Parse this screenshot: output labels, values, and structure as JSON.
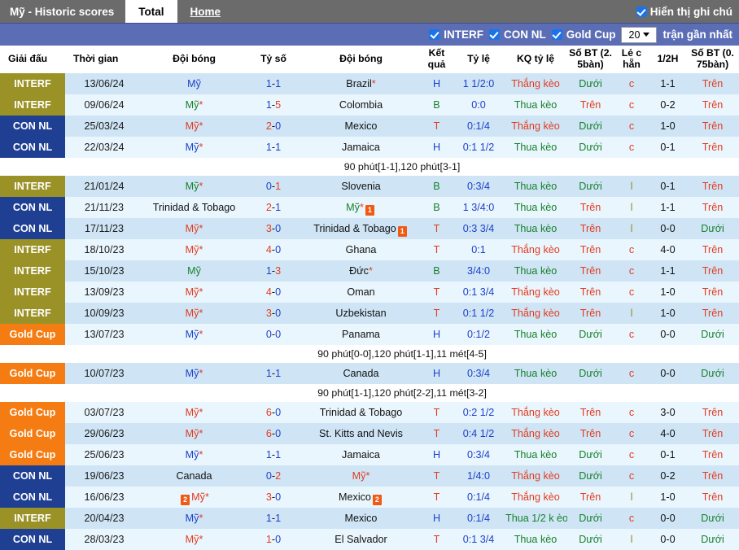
{
  "topbar": {
    "title": "Mỹ - Historic scores",
    "tab_total": "Total",
    "tab_home": "Home",
    "show_notes_label": "Hiển thị ghi chú"
  },
  "filterbar": {
    "f1": "INTERF",
    "f2": "CON NL",
    "f3": "Gold Cup",
    "count_value": "20",
    "count_label": "trận gần nhất"
  },
  "columns": {
    "c0": "Giải đấu",
    "c1": "Thời gian",
    "c2": "Đội bóng",
    "c3": "Tỷ số",
    "c4": "Đội bóng",
    "c5": "Kết quả",
    "c6": "Tỷ lệ",
    "c7": "KQ tỷ lệ",
    "c8": "Số BT (2. 5bàn)",
    "c9": "Lẻ c hẵn",
    "c10": "1/2H",
    "c11": "Số BT (0. 75bàn)"
  },
  "rows": [
    {
      "kind": "match",
      "comp": "INTERF",
      "comp_class": "c-interf",
      "date": "13/06/24",
      "home": "Mỹ",
      "home_class": "tm-blue",
      "home_star": "",
      "home_card": "",
      "score": "1-1",
      "score_h_class": "sc-blue",
      "score_a_class": "sc-blue",
      "away": "Brazil",
      "away_class": "tm-black",
      "away_star": "*",
      "away_card": "",
      "res": "H",
      "res_class": "v-blue",
      "odds": "1 1/2:0",
      "odds_class": "v-blue",
      "kq": "Thắng kèo",
      "kq_class": "v-red",
      "bt25": "Dưới",
      "bt25_class": "v-green",
      "oe": "c",
      "oe_class": "v-red",
      "half": "1-1",
      "half_class": "tm-black",
      "bt075": "Trên",
      "bt075_class": "v-red"
    },
    {
      "kind": "match",
      "comp": "INTERF",
      "comp_class": "c-interf",
      "date": "09/06/24",
      "home": "Mỹ",
      "home_class": "tm-green",
      "home_star": "*",
      "home_card": "",
      "score": "1-5",
      "score_h_class": "sc-blue",
      "score_a_class": "sc-red",
      "away": "Colombia",
      "away_class": "tm-black",
      "away_star": "",
      "away_card": "",
      "res": "B",
      "res_class": "v-green",
      "odds": "0:0",
      "odds_class": "v-blue",
      "kq": "Thua kèo",
      "kq_class": "v-green",
      "bt25": "Trên",
      "bt25_class": "v-red",
      "oe": "c",
      "oe_class": "v-red",
      "half": "0-2",
      "half_class": "tm-black",
      "bt075": "Trên",
      "bt075_class": "v-red"
    },
    {
      "kind": "match",
      "comp": "CON NL",
      "comp_class": "c-connl",
      "date": "25/03/24",
      "home": "Mỹ",
      "home_class": "tm-red",
      "home_star": "*",
      "home_card": "",
      "score": "2-0",
      "score_h_class": "sc-red",
      "score_a_class": "sc-blue",
      "away": "Mexico",
      "away_class": "tm-black",
      "away_star": "",
      "away_card": "",
      "res": "T",
      "res_class": "v-red",
      "odds": "0:1/4",
      "odds_class": "v-blue",
      "kq": "Thắng kèo",
      "kq_class": "v-red",
      "bt25": "Dưới",
      "bt25_class": "v-green",
      "oe": "c",
      "oe_class": "v-red",
      "half": "1-0",
      "half_class": "tm-black",
      "bt075": "Trên",
      "bt075_class": "v-red"
    },
    {
      "kind": "match",
      "comp": "CON NL",
      "comp_class": "c-connl",
      "date": "22/03/24",
      "home": "Mỹ",
      "home_class": "tm-blue",
      "home_star": "*",
      "home_card": "",
      "score": "1-1",
      "score_h_class": "sc-blue",
      "score_a_class": "sc-blue",
      "away": "Jamaica",
      "away_class": "tm-black",
      "away_star": "",
      "away_card": "",
      "res": "H",
      "res_class": "v-blue",
      "odds": "0:1 1/2",
      "odds_class": "v-blue",
      "kq": "Thua kèo",
      "kq_class": "v-green",
      "bt25": "Dưới",
      "bt25_class": "v-green",
      "oe": "c",
      "oe_class": "v-red",
      "half": "0-1",
      "half_class": "tm-black",
      "bt075": "Trên",
      "bt075_class": "v-red"
    },
    {
      "kind": "note",
      "text": "90 phút[1-1],120 phút[3-1]"
    },
    {
      "kind": "match",
      "comp": "INTERF",
      "comp_class": "c-interf",
      "date": "21/01/24",
      "home": "Mỹ",
      "home_class": "tm-green",
      "home_star": "*",
      "home_card": "",
      "score": "0-1",
      "score_h_class": "sc-blue",
      "score_a_class": "sc-red",
      "away": "Slovenia",
      "away_class": "tm-black",
      "away_star": "",
      "away_card": "",
      "res": "B",
      "res_class": "v-green",
      "odds": "0:3/4",
      "odds_class": "v-blue",
      "kq": "Thua kèo",
      "kq_class": "v-green",
      "bt25": "Dưới",
      "bt25_class": "v-green",
      "oe": "l",
      "oe_class": "v-olive",
      "half": "0-1",
      "half_class": "tm-black",
      "bt075": "Trên",
      "bt075_class": "v-red"
    },
    {
      "kind": "match",
      "comp": "CON NL",
      "comp_class": "c-connl",
      "date": "21/11/23",
      "home": "Trinidad & Tobago",
      "home_class": "tm-black",
      "home_star": "",
      "home_card": "",
      "score": "2-1",
      "score_h_class": "sc-red",
      "score_a_class": "sc-blue",
      "away": "Mỹ",
      "away_class": "tm-green",
      "away_star": "*",
      "away_card": "1",
      "res": "B",
      "res_class": "v-green",
      "odds": "1 3/4:0",
      "odds_class": "v-blue",
      "kq": "Thua kèo",
      "kq_class": "v-green",
      "bt25": "Trên",
      "bt25_class": "v-red",
      "oe": "l",
      "oe_class": "v-olive",
      "half": "1-1",
      "half_class": "tm-black",
      "bt075": "Trên",
      "bt075_class": "v-red"
    },
    {
      "kind": "match",
      "comp": "CON NL",
      "comp_class": "c-connl",
      "date": "17/11/23",
      "home": "Mỹ",
      "home_class": "tm-red",
      "home_star": "*",
      "home_card": "",
      "score": "3-0",
      "score_h_class": "sc-red",
      "score_a_class": "sc-blue",
      "away": "Trinidad & Tobago",
      "away_class": "tm-black",
      "away_star": "",
      "away_card": "1",
      "res": "T",
      "res_class": "v-red",
      "odds": "0:3 3/4",
      "odds_class": "v-blue",
      "kq": "Thua kèo",
      "kq_class": "v-green",
      "bt25": "Trên",
      "bt25_class": "v-red",
      "oe": "l",
      "oe_class": "v-olive",
      "half": "0-0",
      "half_class": "tm-black",
      "bt075": "Dưới",
      "bt075_class": "v-green"
    },
    {
      "kind": "match",
      "comp": "INTERF",
      "comp_class": "c-interf",
      "date": "18/10/23",
      "home": "Mỹ",
      "home_class": "tm-red",
      "home_star": "*",
      "home_card": "",
      "score": "4-0",
      "score_h_class": "sc-red",
      "score_a_class": "sc-blue",
      "away": "Ghana",
      "away_class": "tm-black",
      "away_star": "",
      "away_card": "",
      "res": "T",
      "res_class": "v-red",
      "odds": "0:1",
      "odds_class": "v-blue",
      "kq": "Thắng kèo",
      "kq_class": "v-red",
      "bt25": "Trên",
      "bt25_class": "v-red",
      "oe": "c",
      "oe_class": "v-red",
      "half": "4-0",
      "half_class": "tm-black",
      "bt075": "Trên",
      "bt075_class": "v-red"
    },
    {
      "kind": "match",
      "comp": "INTERF",
      "comp_class": "c-interf",
      "date": "15/10/23",
      "home": "Mỹ",
      "home_class": "tm-green",
      "home_star": "",
      "home_card": "",
      "score": "1-3",
      "score_h_class": "sc-blue",
      "score_a_class": "sc-red",
      "away": "Đức",
      "away_class": "tm-black",
      "away_star": "*",
      "away_card": "",
      "res": "B",
      "res_class": "v-green",
      "odds": "3/4:0",
      "odds_class": "v-blue",
      "kq": "Thua kèo",
      "kq_class": "v-green",
      "bt25": "Trên",
      "bt25_class": "v-red",
      "oe": "c",
      "oe_class": "v-red",
      "half": "1-1",
      "half_class": "tm-black",
      "bt075": "Trên",
      "bt075_class": "v-red"
    },
    {
      "kind": "match",
      "comp": "INTERF",
      "comp_class": "c-interf",
      "date": "13/09/23",
      "home": "Mỹ",
      "home_class": "tm-red",
      "home_star": "*",
      "home_card": "",
      "score": "4-0",
      "score_h_class": "sc-red",
      "score_a_class": "sc-blue",
      "away": "Oman",
      "away_class": "tm-black",
      "away_star": "",
      "away_card": "",
      "res": "T",
      "res_class": "v-red",
      "odds": "0:1 3/4",
      "odds_class": "v-blue",
      "kq": "Thắng kèo",
      "kq_class": "v-red",
      "bt25": "Trên",
      "bt25_class": "v-red",
      "oe": "c",
      "oe_class": "v-red",
      "half": "1-0",
      "half_class": "tm-black",
      "bt075": "Trên",
      "bt075_class": "v-red"
    },
    {
      "kind": "match",
      "comp": "INTERF",
      "comp_class": "c-interf",
      "date": "10/09/23",
      "home": "Mỹ",
      "home_class": "tm-red",
      "home_star": "*",
      "home_card": "",
      "score": "3-0",
      "score_h_class": "sc-red",
      "score_a_class": "sc-blue",
      "away": "Uzbekistan",
      "away_class": "tm-black",
      "away_star": "",
      "away_card": "",
      "res": "T",
      "res_class": "v-red",
      "odds": "0:1 1/2",
      "odds_class": "v-blue",
      "kq": "Thắng kèo",
      "kq_class": "v-red",
      "bt25": "Trên",
      "bt25_class": "v-red",
      "oe": "l",
      "oe_class": "v-olive",
      "half": "1-0",
      "half_class": "tm-black",
      "bt075": "Trên",
      "bt075_class": "v-red"
    },
    {
      "kind": "match",
      "comp": "Gold Cup",
      "comp_class": "c-goldcup",
      "date": "13/07/23",
      "home": "Mỹ",
      "home_class": "tm-blue",
      "home_star": "*",
      "home_card": "",
      "score": "0-0",
      "score_h_class": "sc-blue",
      "score_a_class": "sc-blue",
      "away": "Panama",
      "away_class": "tm-black",
      "away_star": "",
      "away_card": "",
      "res": "H",
      "res_class": "v-blue",
      "odds": "0:1/2",
      "odds_class": "v-blue",
      "kq": "Thua kèo",
      "kq_class": "v-green",
      "bt25": "Dưới",
      "bt25_class": "v-green",
      "oe": "c",
      "oe_class": "v-red",
      "half": "0-0",
      "half_class": "tm-black",
      "bt075": "Dưới",
      "bt075_class": "v-green"
    },
    {
      "kind": "note",
      "text": "90 phút[0-0],120 phút[1-1],11 mét[4-5]"
    },
    {
      "kind": "match",
      "comp": "Gold Cup",
      "comp_class": "c-goldcup",
      "date": "10/07/23",
      "home": "Mỹ",
      "home_class": "tm-blue",
      "home_star": "*",
      "home_card": "",
      "score": "1-1",
      "score_h_class": "sc-blue",
      "score_a_class": "sc-blue",
      "away": "Canada",
      "away_class": "tm-black",
      "away_star": "",
      "away_card": "",
      "res": "H",
      "res_class": "v-blue",
      "odds": "0:3/4",
      "odds_class": "v-blue",
      "kq": "Thua kèo",
      "kq_class": "v-green",
      "bt25": "Dưới",
      "bt25_class": "v-green",
      "oe": "c",
      "oe_class": "v-red",
      "half": "0-0",
      "half_class": "tm-black",
      "bt075": "Dưới",
      "bt075_class": "v-green"
    },
    {
      "kind": "note",
      "text": "90 phút[1-1],120 phút[2-2],11 mét[3-2]"
    },
    {
      "kind": "match",
      "comp": "Gold Cup",
      "comp_class": "c-goldcup",
      "date": "03/07/23",
      "home": "Mỹ",
      "home_class": "tm-red",
      "home_star": "*",
      "home_card": "",
      "score": "6-0",
      "score_h_class": "sc-red",
      "score_a_class": "sc-blue",
      "away": "Trinidad & Tobago",
      "away_class": "tm-black",
      "away_star": "",
      "away_card": "",
      "res": "T",
      "res_class": "v-red",
      "odds": "0:2 1/2",
      "odds_class": "v-blue",
      "kq": "Thắng kèo",
      "kq_class": "v-red",
      "bt25": "Trên",
      "bt25_class": "v-red",
      "oe": "c",
      "oe_class": "v-red",
      "half": "3-0",
      "half_class": "tm-black",
      "bt075": "Trên",
      "bt075_class": "v-red"
    },
    {
      "kind": "match",
      "comp": "Gold Cup",
      "comp_class": "c-goldcup",
      "date": "29/06/23",
      "home": "Mỹ",
      "home_class": "tm-red",
      "home_star": "*",
      "home_card": "",
      "score": "6-0",
      "score_h_class": "sc-red",
      "score_a_class": "sc-blue",
      "away": "St. Kitts and Nevis",
      "away_class": "tm-black",
      "away_star": "",
      "away_card": "",
      "res": "T",
      "res_class": "v-red",
      "odds": "0:4 1/2",
      "odds_class": "v-blue",
      "kq": "Thắng kèo",
      "kq_class": "v-red",
      "bt25": "Trên",
      "bt25_class": "v-red",
      "oe": "c",
      "oe_class": "v-red",
      "half": "4-0",
      "half_class": "tm-black",
      "bt075": "Trên",
      "bt075_class": "v-red"
    },
    {
      "kind": "match",
      "comp": "Gold Cup",
      "comp_class": "c-goldcup",
      "date": "25/06/23",
      "home": "Mỹ",
      "home_class": "tm-blue",
      "home_star": "*",
      "home_card": "",
      "score": "1-1",
      "score_h_class": "sc-blue",
      "score_a_class": "sc-blue",
      "away": "Jamaica",
      "away_class": "tm-black",
      "away_star": "",
      "away_card": "",
      "res": "H",
      "res_class": "v-blue",
      "odds": "0:3/4",
      "odds_class": "v-blue",
      "kq": "Thua kèo",
      "kq_class": "v-green",
      "bt25": "Dưới",
      "bt25_class": "v-green",
      "oe": "c",
      "oe_class": "v-red",
      "half": "0-1",
      "half_class": "tm-black",
      "bt075": "Trên",
      "bt075_class": "v-red"
    },
    {
      "kind": "match",
      "comp": "CON NL",
      "comp_class": "c-connl",
      "date": "19/06/23",
      "home": "Canada",
      "home_class": "tm-black",
      "home_star": "",
      "home_card": "",
      "score": "0-2",
      "score_h_class": "sc-blue",
      "score_a_class": "sc-red",
      "away": "Mỹ",
      "away_class": "tm-red",
      "away_star": "*",
      "away_card": "",
      "res": "T",
      "res_class": "v-red",
      "odds": "1/4:0",
      "odds_class": "v-blue",
      "kq": "Thắng kèo",
      "kq_class": "v-red",
      "bt25": "Dưới",
      "bt25_class": "v-green",
      "oe": "c",
      "oe_class": "v-red",
      "half": "0-2",
      "half_class": "tm-black",
      "bt075": "Trên",
      "bt075_class": "v-red"
    },
    {
      "kind": "match",
      "comp": "CON NL",
      "comp_class": "c-connl",
      "date": "16/06/23",
      "home": "Mỹ",
      "home_class": "tm-red",
      "home_star": "*",
      "home_card": "2",
      "score": "3-0",
      "score_h_class": "sc-red",
      "score_a_class": "sc-blue",
      "away": "Mexico",
      "away_class": "tm-black",
      "away_star": "",
      "away_card": "2",
      "res": "T",
      "res_class": "v-red",
      "odds": "0:1/4",
      "odds_class": "v-blue",
      "kq": "Thắng kèo",
      "kq_class": "v-red",
      "bt25": "Trên",
      "bt25_class": "v-red",
      "oe": "l",
      "oe_class": "v-olive",
      "half": "1-0",
      "half_class": "tm-black",
      "bt075": "Trên",
      "bt075_class": "v-red"
    },
    {
      "kind": "match",
      "comp": "INTERF",
      "comp_class": "c-interf",
      "date": "20/04/23",
      "home": "Mỹ",
      "home_class": "tm-blue",
      "home_star": "*",
      "home_card": "",
      "score": "1-1",
      "score_h_class": "sc-blue",
      "score_a_class": "sc-blue",
      "away": "Mexico",
      "away_class": "tm-black",
      "away_star": "",
      "away_card": "",
      "res": "H",
      "res_class": "v-blue",
      "odds": "0:1/4",
      "odds_class": "v-blue",
      "kq": "Thua 1/2 k èo",
      "kq_class": "v-green",
      "bt25": "Dưới",
      "bt25_class": "v-green",
      "oe": "c",
      "oe_class": "v-red",
      "half": "0-0",
      "half_class": "tm-black",
      "bt075": "Dưới",
      "bt075_class": "v-green"
    },
    {
      "kind": "match",
      "comp": "CON NL",
      "comp_class": "c-connl",
      "date": "28/03/23",
      "home": "Mỹ",
      "home_class": "tm-red",
      "home_star": "*",
      "home_card": "",
      "score": "1-0",
      "score_h_class": "sc-red",
      "score_a_class": "sc-blue",
      "away": "El Salvador",
      "away_class": "tm-black",
      "away_star": "",
      "away_card": "",
      "res": "T",
      "res_class": "v-red",
      "odds": "0:1 3/4",
      "odds_class": "v-blue",
      "kq": "Thua kèo",
      "kq_class": "v-green",
      "bt25": "Dưới",
      "bt25_class": "v-green",
      "oe": "l",
      "oe_class": "v-olive",
      "half": "0-0",
      "half_class": "tm-black",
      "bt075": "Dưới",
      "bt075_class": "v-green"
    }
  ]
}
